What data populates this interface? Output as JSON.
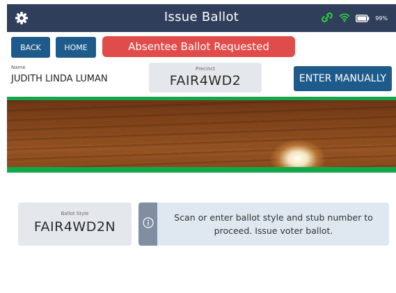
{
  "header": {
    "title": "Issue Ballot",
    "battery_text": "99%",
    "icons": [
      "gear-icon",
      "link-icon",
      "wifi-icon",
      "battery-icon"
    ],
    "background": "#2f3e5a",
    "status_icon_color": "#2ecc40"
  },
  "toolbar": {
    "back_label": "BACK",
    "home_label": "HOME",
    "alert_text": "Absentee Ballot Requested",
    "alert_color": "#e04c4a",
    "button_color": "#1f5b8a"
  },
  "voter": {
    "name_label": "Name",
    "name_value": "JUDITH LINDA LUMAN",
    "precinct_label": "Precinct",
    "precinct_value": "FAIR4WD2",
    "enter_manually_label": "ENTER MANUALLY"
  },
  "camera": {
    "border_color": "#12a84a"
  },
  "ballot": {
    "style_label": "Ballot Style",
    "style_value": "FAIR4WD2N",
    "info_icon": "info-icon",
    "info_text": "Scan or enter ballot style and stub number to proceed. Issue voter ballot."
  }
}
